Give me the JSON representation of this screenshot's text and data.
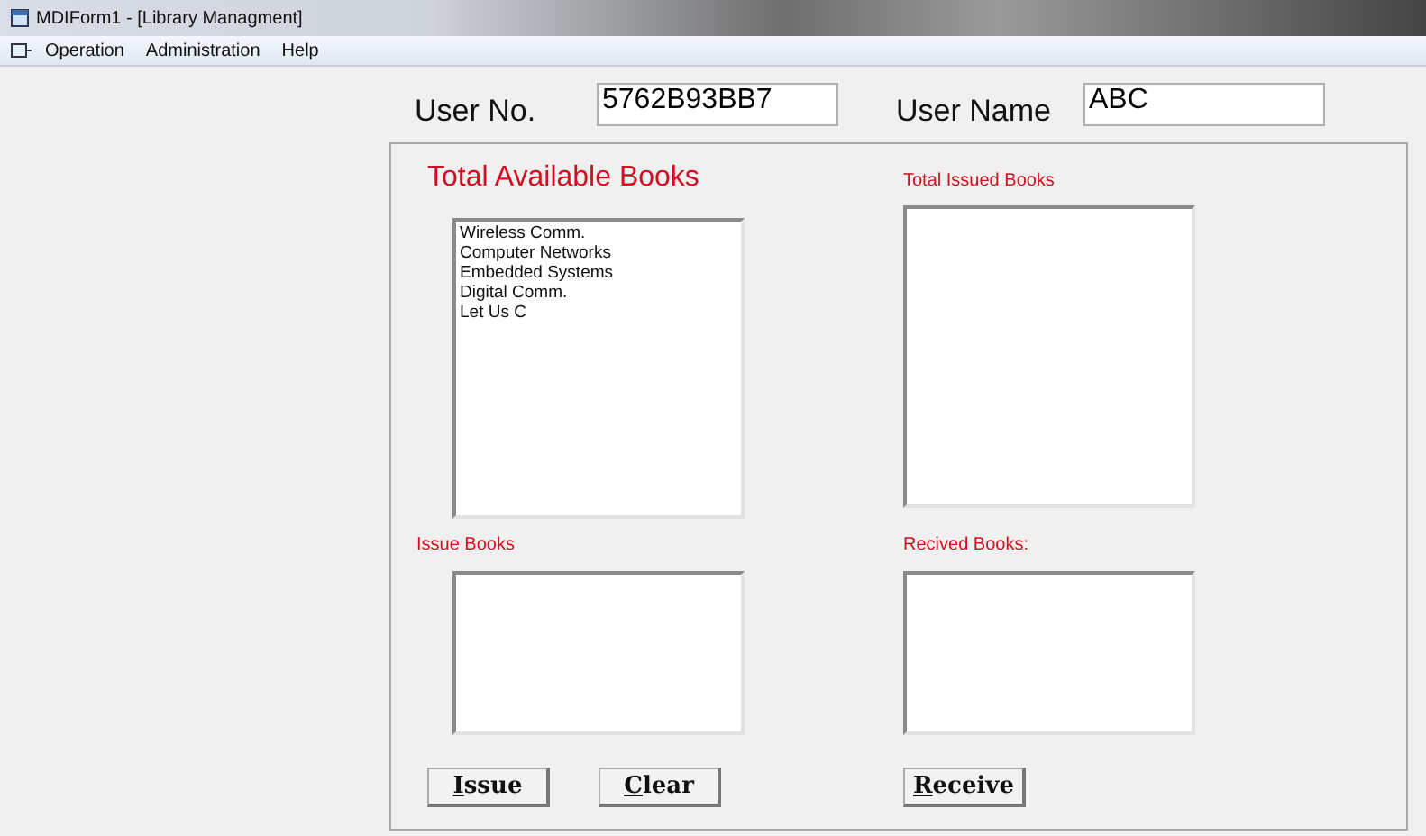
{
  "window": {
    "title": "MDIForm1 - [Library Managment]"
  },
  "menu": [
    "Operation",
    "Administration",
    "Help"
  ],
  "user": {
    "number_label": "User No.",
    "number_value": "5762B93BB7",
    "name_label": "User Name",
    "name_value": "ABC"
  },
  "available": {
    "title": "Total Available Books",
    "items": [
      "Wireless Comm.",
      "Computer Networks",
      "Embedded Systems",
      "Digital Comm.",
      "Let Us C"
    ]
  },
  "issued": {
    "title": "Total Issued Books"
  },
  "issue": {
    "title": "Issue Books"
  },
  "received": {
    "title": "Recived Books:"
  },
  "buttons": {
    "left": [
      "Issue",
      "Clear"
    ],
    "right": [
      "Receive"
    ]
  }
}
